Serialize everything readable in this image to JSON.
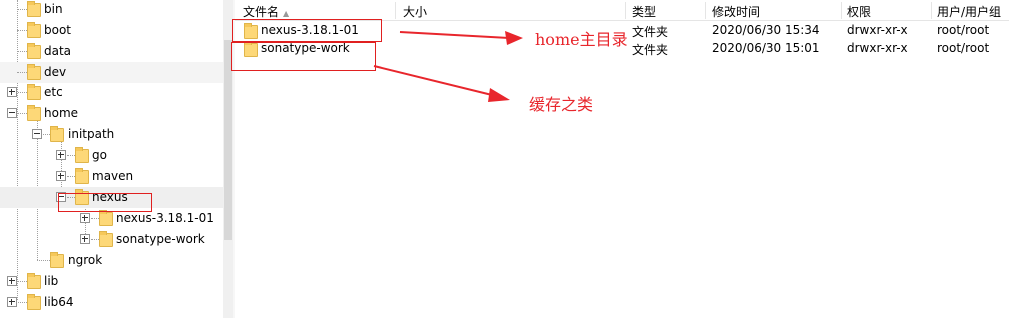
{
  "tree": {
    "items": [
      {
        "label": "bin"
      },
      {
        "label": "boot"
      },
      {
        "label": "data"
      },
      {
        "label": "dev"
      },
      {
        "label": "etc"
      },
      {
        "label": "home"
      },
      {
        "label": "initpath"
      },
      {
        "label": "go"
      },
      {
        "label": "maven"
      },
      {
        "label": "nexus"
      },
      {
        "label": "nexus-3.18.1-01"
      },
      {
        "label": "sonatype-work"
      },
      {
        "label": "ngrok"
      },
      {
        "label": "lib"
      },
      {
        "label": "lib64"
      }
    ]
  },
  "columns": {
    "name": "文件名",
    "size": "大小",
    "type": "类型",
    "modified": "修改时间",
    "perms": "权限",
    "owner": "用户/用户组"
  },
  "files": [
    {
      "name": "nexus-3.18.1-01",
      "size": "",
      "type": "文件夹",
      "modified": "2020/06/30 15:34",
      "perms": "drwxr-xr-x",
      "owner": "root/root"
    },
    {
      "name": "sonatype-work",
      "size": "",
      "type": "文件夹",
      "modified": "2020/06/30 15:01",
      "perms": "drwxr-xr-x",
      "owner": "root/root"
    }
  ],
  "annotations": {
    "home_label": "home主目录",
    "cache_label": "缓存之类"
  },
  "colors": {
    "annotation_red": "#e8262c",
    "folder_yellow": "#fdd878",
    "selected_row": "#efefef"
  }
}
